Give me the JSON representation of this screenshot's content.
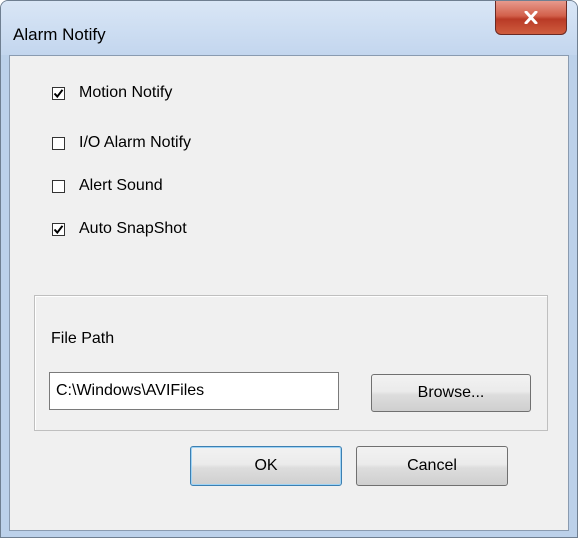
{
  "window": {
    "title": "Alarm Notify",
    "close_label": "X"
  },
  "options": [
    {
      "label": "Motion Notify",
      "checked": true
    },
    {
      "label": "I/O Alarm Notify",
      "checked": false
    },
    {
      "label": "Alert Sound",
      "checked": false
    },
    {
      "label": "Auto SnapShot",
      "checked": true
    }
  ],
  "file_path": {
    "label": "File Path",
    "value": "C:\\Windows\\AVIFiles",
    "browse_label": "Browse..."
  },
  "buttons": {
    "ok_label": "OK",
    "cancel_label": "Cancel"
  },
  "colors": {
    "title_bar": "#c3d6ee",
    "close_button": "#c7432d",
    "dialog_background": "#f0f0f0"
  }
}
